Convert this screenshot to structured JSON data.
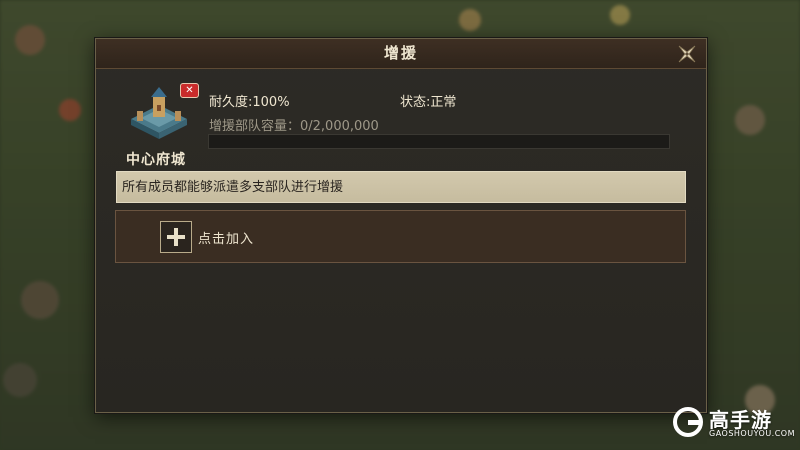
{
  "dialog": {
    "title": "增援",
    "close_icon": "close-x-icon"
  },
  "fortress": {
    "name": "中心府城",
    "icon": "castle-icon",
    "remove_badge": "✕"
  },
  "stats": {
    "durability": "耐久度:100%",
    "status": "状态:正常",
    "capacity": "增援部队容量：0/2,000,000",
    "capacity_fill_fraction": 0
  },
  "notice": "所有成员都能够派遣多支部队进行增援",
  "join_slot": {
    "label": "点击加入",
    "icon": "plus-icon"
  },
  "watermark": {
    "brand": "高手游",
    "url": "GAOSHOUYOU.COM"
  },
  "colors": {
    "progress": "#7ba64a",
    "badge": "#c92b2b",
    "panel": "#2d2b26"
  }
}
